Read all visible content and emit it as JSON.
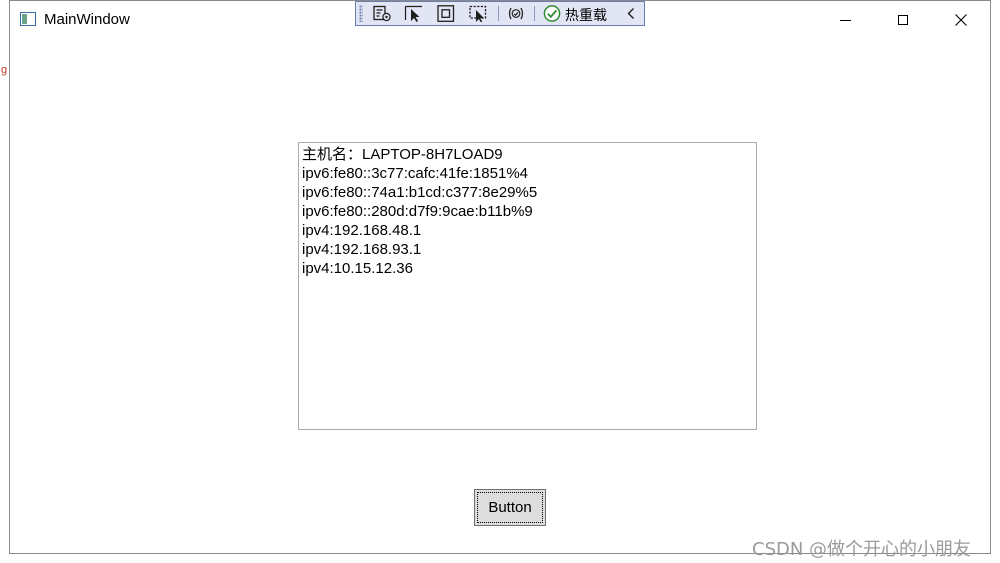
{
  "window": {
    "title": "MainWindow"
  },
  "devbar": {
    "hot_reload_label": "热重载",
    "icons": [
      "live-visual-tree-icon",
      "select-element-icon",
      "display-layout-adorners-icon",
      "track-focused-element-icon",
      "binding-failures-icon",
      "hot-reload-check-icon",
      "collapse-chevron-icon"
    ]
  },
  "textbox": {
    "lines": [
      "主机名：LAPTOP-8H7LOAD9",
      "ipv6:fe80::3c77:cafc:41fe:1851%4",
      "ipv6:fe80::74a1:b1cd:c377:8e29%5",
      "ipv6:fe80::280d:d7f9:9cae:b11b%9",
      "ipv4:192.168.48.1",
      "ipv4:192.168.93.1",
      "ipv4:10.15.12.36"
    ]
  },
  "button": {
    "label": "Button"
  },
  "background": {
    "stray_char": "g"
  },
  "watermark": {
    "text": "CSDN @做个开心的小朋友"
  }
}
